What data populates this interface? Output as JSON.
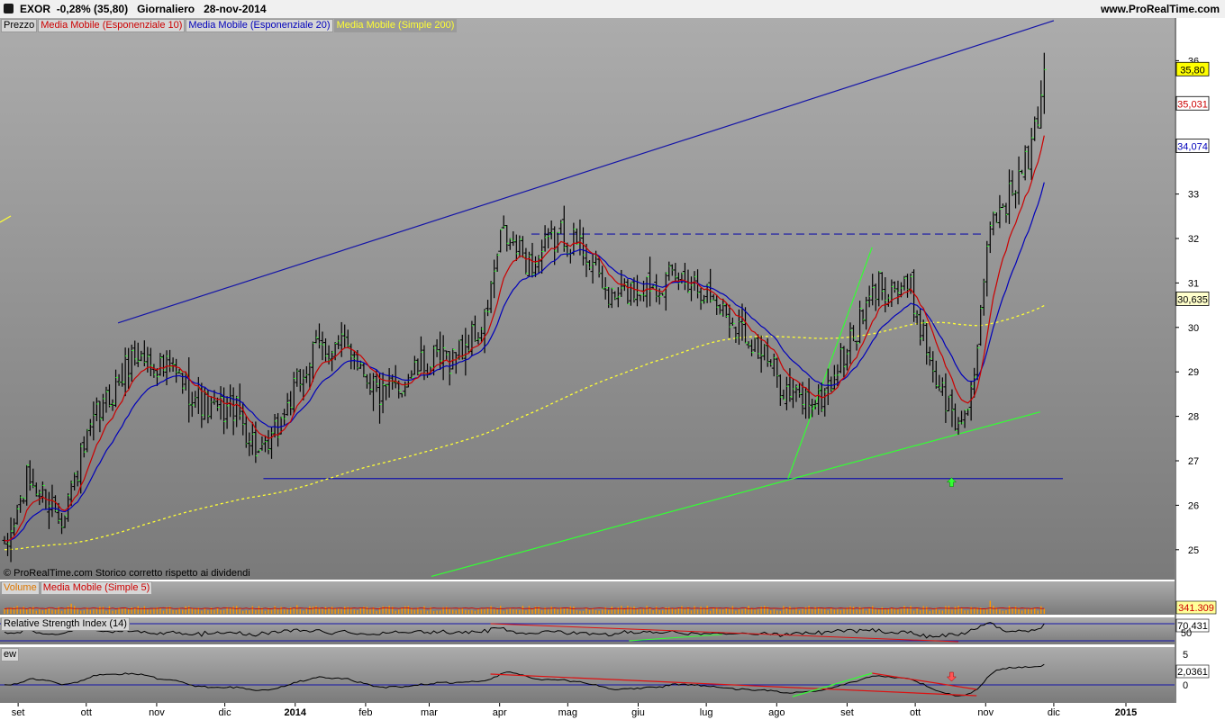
{
  "header": {
    "symbol": "EXOR",
    "change": "-0,28% (35,80)",
    "period": "Giornaliero",
    "date": "28-nov-2014",
    "site": "www.ProRealTime.com"
  },
  "colors": {
    "background_top": "#aaaaaa",
    "background_bottom": "#7c7c7c",
    "ema10": "#cc0000",
    "ema20": "#0000bb",
    "sma200": "#ffff33",
    "trend_blue": "#1414a8",
    "trend_green": "#33ff33",
    "trend_red": "#dd1111",
    "up_arrow": "#33ff33",
    "down_arrow": "#ff5555"
  },
  "price_panel": {
    "legend": [
      "Prezzo",
      "Media Mobile (Esponenziale 10)",
      "Media Mobile (Esponenziale 20)",
      "Media Mobile (Simple 200)"
    ],
    "footer": "© ProRealTime.com  Storico corretto rispetto ai dividendi",
    "value_labels": [
      "35,80",
      "35,031",
      "34,074",
      "30,635"
    ]
  },
  "volume_panel": {
    "legend": [
      "Volume",
      "Media Mobile (Simple 5)"
    ],
    "value_label": "341.309"
  },
  "rsi_panel": {
    "legend": [
      "Relative Strength Index (14)"
    ],
    "value_label": "70,431",
    "ticks": [
      "50"
    ]
  },
  "ew_panel": {
    "legend": [
      "ew"
    ],
    "value_label": "2,0361",
    "ticks": [
      "5",
      "0"
    ]
  },
  "chart_data": [
    {
      "type": "ohlc",
      "title": "EXOR",
      "period": "daily",
      "x_ticks": [
        "set",
        "ott",
        "nov",
        "dic",
        "2014",
        "feb",
        "mar",
        "apr",
        "mag",
        "giu",
        "lug",
        "ago",
        "set",
        "ott",
        "nov",
        "dic",
        "2015"
      ],
      "ylim": [
        24.4,
        36.9
      ],
      "y_ticks": [
        25,
        26,
        27,
        28,
        29,
        30,
        31,
        32,
        33,
        36
      ],
      "series": [
        {
          "name": "Prezzo",
          "close_knots": [
            [
              "2013-08-26",
              24.9
            ],
            [
              "2013-09-05",
              26.6
            ],
            [
              "2013-09-20",
              25.8
            ],
            [
              "2013-10-05",
              27.9
            ],
            [
              "2013-10-22",
              29.4
            ],
            [
              "2013-11-08",
              29.0
            ],
            [
              "2013-11-25",
              28.1
            ],
            [
              "2013-12-05",
              28.2
            ],
            [
              "2013-12-18",
              27.0
            ],
            [
              "2013-12-31",
              28.5
            ],
            [
              "2014-01-10",
              29.5
            ],
            [
              "2014-01-25",
              29.6
            ],
            [
              "2014-02-08",
              28.4
            ],
            [
              "2014-02-25",
              29.1
            ],
            [
              "2014-03-10",
              29.3
            ],
            [
              "2014-03-25",
              30.0
            ],
            [
              "2014-04-02",
              32.1
            ],
            [
              "2014-04-15",
              31.4
            ],
            [
              "2014-04-28",
              32.1
            ],
            [
              "2014-05-08",
              31.8
            ],
            [
              "2014-05-20",
              30.6
            ],
            [
              "2014-06-05",
              31.0
            ],
            [
              "2014-06-25",
              31.1
            ],
            [
              "2014-07-10",
              30.3
            ],
            [
              "2014-07-22",
              29.7
            ],
            [
              "2014-08-06",
              28.5
            ],
            [
              "2014-08-20",
              28.3
            ],
            [
              "2014-09-02",
              29.6
            ],
            [
              "2014-09-15",
              31.0
            ],
            [
              "2014-09-29",
              30.8
            ],
            [
              "2014-10-10",
              28.9
            ],
            [
              "2014-10-20",
              27.7
            ],
            [
              "2014-10-28",
              29.1
            ],
            [
              "2014-11-03",
              32.4
            ],
            [
              "2014-11-12",
              33.0
            ],
            [
              "2014-11-20",
              33.8
            ],
            [
              "2014-11-28",
              35.8
            ]
          ]
        },
        {
          "name": "Media Mobile (Esponenziale 10)",
          "last": 35.031
        },
        {
          "name": "Media Mobile (Esponenziale 20)",
          "last": 34.074
        },
        {
          "name": "Media Mobile (Simple 200)",
          "last": 30.635,
          "style": "dashed"
        }
      ],
      "trend_lines": [
        {
          "color": "blue",
          "from": [
            "2013-10-15",
            30.1
          ],
          "to": [
            "2014-12-01",
            36.9
          ]
        },
        {
          "color": "blue",
          "from": [
            "2013-12-18",
            26.6
          ],
          "to": [
            "2014-12-05",
            26.6
          ]
        },
        {
          "color": "blue",
          "style": "dashed",
          "from": [
            "2014-04-15",
            32.1
          ],
          "to": [
            "2014-10-30",
            32.1
          ]
        },
        {
          "color": "green",
          "from": [
            "2014-03-02",
            24.4
          ],
          "to": [
            "2014-11-25",
            28.1
          ]
        },
        {
          "color": "green",
          "from": [
            "2014-08-06",
            26.6
          ],
          "to": [
            "2014-09-12",
            31.8
          ]
        }
      ],
      "arrows": [
        {
          "direction": "up",
          "date": "2014-10-17",
          "value": 26.5
        }
      ]
    },
    {
      "type": "bar",
      "title": "Volume",
      "last": 341309,
      "spikes": [
        [
          "2013-09-24",
          3.5
        ],
        [
          "2014-01-02",
          3.0
        ],
        [
          "2014-03-26",
          4.0
        ],
        [
          "2014-04-17",
          2.5
        ],
        [
          "2014-11-03",
          4.5
        ],
        [
          "2014-11-05",
          2.8
        ]
      ]
    },
    {
      "type": "line",
      "title": "Relative Strength Index (14)",
      "y_ticks": [
        50
      ],
      "last": 70.431
    },
    {
      "type": "line",
      "title": "ew",
      "y_ticks": [
        0,
        5
      ],
      "last": 2.0361,
      "arrows": [
        {
          "direction": "down",
          "date": "2014-10-17"
        }
      ]
    }
  ]
}
